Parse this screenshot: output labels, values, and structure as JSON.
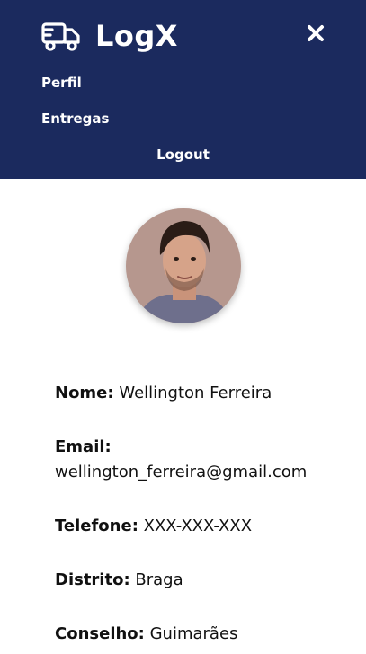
{
  "brand": {
    "name": "LogX",
    "icon": "truck-icon"
  },
  "nav": {
    "close_icon": "close-icon",
    "links": [
      {
        "label": "Perfil"
      },
      {
        "label": "Entregas"
      },
      {
        "label": "Logout"
      }
    ]
  },
  "profile": {
    "avatar": "avatar",
    "fields": {
      "nome": {
        "label": "Nome:",
        "value": "Wellington Ferreira"
      },
      "email": {
        "label": "Email:",
        "value": "wellington_ferreira@gmail.com"
      },
      "telefone": {
        "label": "Telefone:",
        "value": "XXX-XXX-XXX"
      },
      "distrito": {
        "label": "Distrito:",
        "value": "Braga"
      },
      "conselho": {
        "label": "Conselho:",
        "value": "Guimarães"
      }
    }
  },
  "colors": {
    "navbar_bg": "#1b2a5e",
    "nav_text": "#ffffff",
    "body_text": "#111111"
  }
}
